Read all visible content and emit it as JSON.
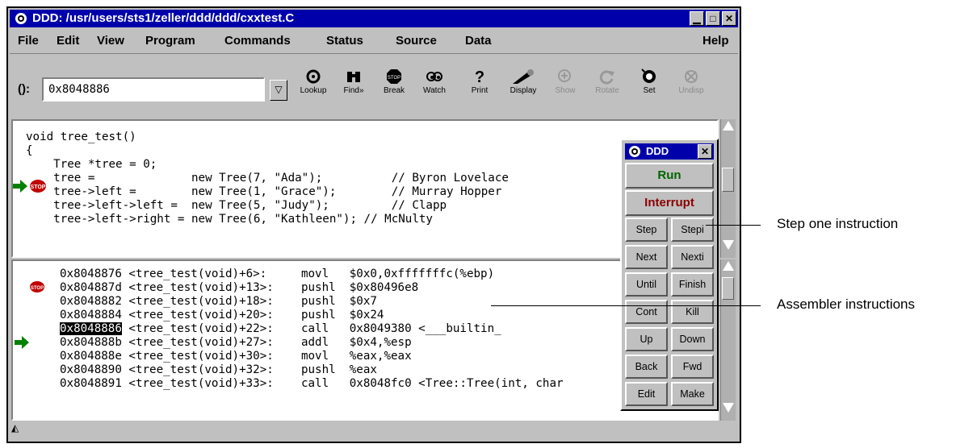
{
  "window": {
    "title": "DDD: /usr/users/sts1/zeller/ddd/ddd/cxxtest.C",
    "min": "▁",
    "max": "□",
    "close": "✕"
  },
  "menu": [
    "File",
    "Edit",
    "View",
    "Program",
    "Commands",
    "Status",
    "Source",
    "Data",
    "Help"
  ],
  "argument": {
    "label": "():",
    "value": "0x8048886",
    "dropdown": "▽"
  },
  "toolbar": [
    "Lookup",
    "Find»",
    "Break",
    "Watch",
    "Print",
    "Display",
    "Show",
    "Rotate",
    "Set",
    "Undisp"
  ],
  "source": {
    "lines": [
      "void tree_test()",
      "{",
      "    Tree *tree = 0;",
      "    tree =              new Tree(7, \"Ada\");          // Byron Lovelace",
      "    tree->left =        new Tree(1, \"Grace\");        // Murray Hopper",
      "    tree->left->left =  new Tree(5, \"Judy\");         // Clapp",
      "    tree->left->right = new Tree(6, \"Kathleen\"); // McNulty"
    ]
  },
  "machine": {
    "before": [
      "0x8048876 <tree_test(void)+6>:     movl   $0x0,0xfffffffc(%ebp)",
      "0x804887d <tree_test(void)+13>:    pushl  $0x80496e8",
      "0x8048882 <tree_test(void)+18>:    pushl  $0x7",
      "0x8048884 <tree_test(void)+20>:    pushl  $0x24"
    ],
    "current_addr": "0x8048886",
    "current_rest": " <tree_test(void)+22>:    call   0x8049380 <___builtin_",
    "after": [
      "0x804888b <tree_test(void)+27>:    addl   $0x4,%esp",
      "0x804888e <tree_test(void)+30>:    movl   %eax,%eax",
      "0x8048890 <tree_test(void)+32>:    pushl  %eax",
      "0x8048891 <tree_test(void)+33>:    call   0x8048fc0 <Tree::Tree(int, char"
    ]
  },
  "status_icon": "◭",
  "panel": {
    "title": "DDD",
    "close": "✕",
    "run": "Run",
    "interrupt": "Interrupt",
    "buttons": [
      [
        "Step",
        "Stepi"
      ],
      [
        "Next",
        "Nexti"
      ],
      [
        "Until",
        "Finish"
      ],
      [
        "Cont",
        "Kill"
      ],
      [
        "Up",
        "Down"
      ],
      [
        "Back",
        "Fwd"
      ],
      [
        "Edit",
        "Make"
      ]
    ]
  },
  "annotations": {
    "step": "Step one instruction",
    "asm": "Assembler instructions"
  },
  "colors": {
    "title_bar": "#0000aa",
    "run": "#006400",
    "interrupt": "#8b0000",
    "arrow": "#008000",
    "stop": "#c00000"
  }
}
